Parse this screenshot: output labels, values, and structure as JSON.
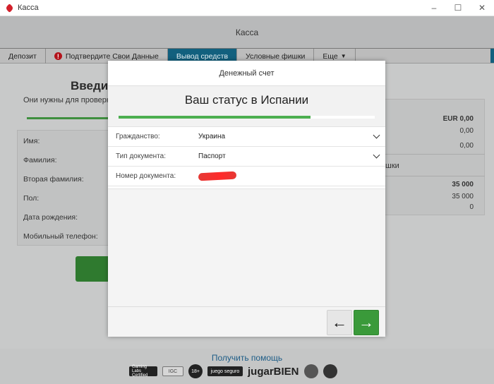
{
  "window": {
    "title": "Касса",
    "minimize": "–",
    "maximize": "☐",
    "close": "✕"
  },
  "app": {
    "header_title": "Касса"
  },
  "tabs": [
    {
      "label": "Депозит"
    },
    {
      "label": "Подтвердите Свои Данные",
      "warning": "!"
    },
    {
      "label": "Вывод средств",
      "active": true
    },
    {
      "label": "Условные фишки"
    },
    {
      "label": "Еще",
      "dropdown": "▼"
    }
  ],
  "background": {
    "heading": "Введите",
    "subtitle": "Они нужны для проверки",
    "fields": [
      "Имя:",
      "Фамилия:",
      "Вторая фамилия:",
      "Пол:",
      "Дата рождения:",
      "Мобильный телефон:"
    ],
    "balance": {
      "currency_total": "EUR 0,00",
      "line1": "0,00",
      "line2": "0,00",
      "label": "шки",
      "points_total": "35 000",
      "points_1": "35 000",
      "points_2": "0"
    }
  },
  "modal": {
    "header": "Денежный счет",
    "status_title": "Ваш статус в Испании",
    "progress": 0.75,
    "rows": [
      {
        "label": "Гражданство:",
        "value": "Украина",
        "dropdown": true
      },
      {
        "label": "Тип документа:",
        "value": "Паспорт",
        "dropdown": true
      },
      {
        "label": "Номер документа:",
        "value": "",
        "redacted": true
      }
    ],
    "back_button": "←",
    "next_button": "→"
  },
  "footer": {
    "help_link": "Получить помощь",
    "badges": [
      "Gaming Labs Certified",
      "IGC",
      "18+",
      "juego seguro",
      "jugarBIEN",
      "",
      ""
    ]
  },
  "colors": {
    "active_tab": "#12607e",
    "accent_green": "#3a9a3a",
    "progress": "#4caf50",
    "warning": "#b3131b"
  }
}
